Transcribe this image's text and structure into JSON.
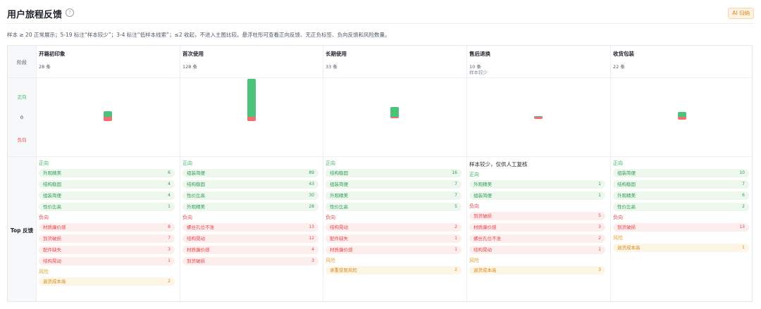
{
  "header": {
    "title": "用户旅程反馈",
    "help_icon": "?",
    "ai_badge": "AI 归纳"
  },
  "note": "样本 ≥ 20 正常展示；5-19 标注“样本较少”；3-4 标注“低样本线索”；≤2 收起，不进入主图比较。悬浮柱形可查看正向反馈、无正负标签、负向反馈和风险数量。",
  "row_labels": {
    "stage": "阶段",
    "positive": "正向",
    "zero": "0",
    "negative": "负向",
    "top_feedback": "Top 反馈"
  },
  "colors": {
    "positive": "#4cc37a",
    "negative": "#f07070",
    "risk": "#e0a12b"
  },
  "stages": [
    {
      "name": "开箱初印象",
      "count": "28 条",
      "warn": "",
      "chart": {
        "positive": 16,
        "negative": 11
      },
      "low_sample_note": "",
      "sections": [
        {
          "label": "正向",
          "kind": "pos",
          "items": [
            {
              "label": "外观精美",
              "value": "6"
            },
            {
              "label": "结构稳固",
              "value": "4"
            },
            {
              "label": "组装简便",
              "value": "4"
            },
            {
              "label": "性价比高",
              "value": "1"
            }
          ]
        },
        {
          "label": "负向",
          "kind": "neg",
          "items": [
            {
              "label": "材质廉价感",
              "value": "8"
            },
            {
              "label": "到货破损",
              "value": "7"
            },
            {
              "label": "配件缺失",
              "value": "3"
            },
            {
              "label": "结构晃动",
              "value": "1"
            }
          ]
        },
        {
          "label": "风险",
          "kind": "risk",
          "items": [
            {
              "label": "退货成本高",
              "value": "2"
            }
          ]
        }
      ]
    },
    {
      "name": "首次使用",
      "count": "128 条",
      "warn": "",
      "chart": {
        "positive": 108,
        "negative": 11
      },
      "low_sample_note": "",
      "sections": [
        {
          "label": "正向",
          "kind": "pos",
          "items": [
            {
              "label": "组装简便",
              "value": "89"
            },
            {
              "label": "结构稳固",
              "value": "43"
            },
            {
              "label": "性价比高",
              "value": "30"
            },
            {
              "label": "外观精美",
              "value": "28"
            }
          ]
        },
        {
          "label": "负向",
          "kind": "neg",
          "items": [
            {
              "label": "螺丝孔位不准",
              "value": "13"
            },
            {
              "label": "结构晃动",
              "value": "12"
            },
            {
              "label": "材质廉价感",
              "value": "4"
            },
            {
              "label": "到货破损",
              "value": "3"
            }
          ]
        }
      ]
    },
    {
      "name": "长期使用",
      "count": "33 条",
      "warn": "",
      "chart": {
        "positive": 28,
        "negative": 3
      },
      "low_sample_note": "",
      "sections": [
        {
          "label": "正向",
          "kind": "pos",
          "items": [
            {
              "label": "结构稳固",
              "value": "16"
            },
            {
              "label": "组装简便",
              "value": "7"
            },
            {
              "label": "外观精美",
              "value": "7"
            },
            {
              "label": "性价比高",
              "value": "5"
            }
          ]
        },
        {
          "label": "负向",
          "kind": "neg",
          "items": [
            {
              "label": "结构晃动",
              "value": "2"
            },
            {
              "label": "配件缺失",
              "value": "1"
            },
            {
              "label": "材质廉价感",
              "value": "1"
            }
          ]
        },
        {
          "label": "风险",
          "kind": "risk",
          "items": [
            {
              "label": "承重受限风险",
              "value": "2"
            }
          ]
        }
      ]
    },
    {
      "name": "售后退换",
      "count": "10 条",
      "warn": "样本较少",
      "chart": {
        "positive": 2,
        "negative": 6
      },
      "low_sample_note": "样本较少，仅供人工复核",
      "sections": [
        {
          "label": "正向",
          "kind": "pos",
          "items": [
            {
              "label": "外观精美",
              "value": "1"
            },
            {
              "label": "组装简便",
              "value": "1"
            }
          ]
        },
        {
          "label": "负向",
          "kind": "neg",
          "items": [
            {
              "label": "到货破损",
              "value": "5"
            },
            {
              "label": "材质廉价感",
              "value": "3"
            },
            {
              "label": "螺丝孔位不准",
              "value": "2"
            },
            {
              "label": "结构晃动",
              "value": "1"
            }
          ]
        },
        {
          "label": "风险",
          "kind": "risk",
          "items": [
            {
              "label": "退货成本高",
              "value": "3"
            }
          ]
        }
      ]
    },
    {
      "name": "收货包装",
      "count": "22 条",
      "warn": "",
      "chart": {
        "positive": 13,
        "negative": 8
      },
      "low_sample_note": "",
      "sections": [
        {
          "label": "正向",
          "kind": "pos",
          "items": [
            {
              "label": "组装简便",
              "value": "10"
            },
            {
              "label": "结构稳固",
              "value": "7"
            },
            {
              "label": "外观精美",
              "value": "6"
            },
            {
              "label": "性价比高",
              "value": "2"
            }
          ]
        },
        {
          "label": "负向",
          "kind": "neg",
          "items": [
            {
              "label": "到货破损",
              "value": "13"
            }
          ]
        },
        {
          "label": "风险",
          "kind": "risk",
          "items": [
            {
              "label": "退货成本高",
              "value": "1"
            }
          ]
        }
      ]
    }
  ]
}
